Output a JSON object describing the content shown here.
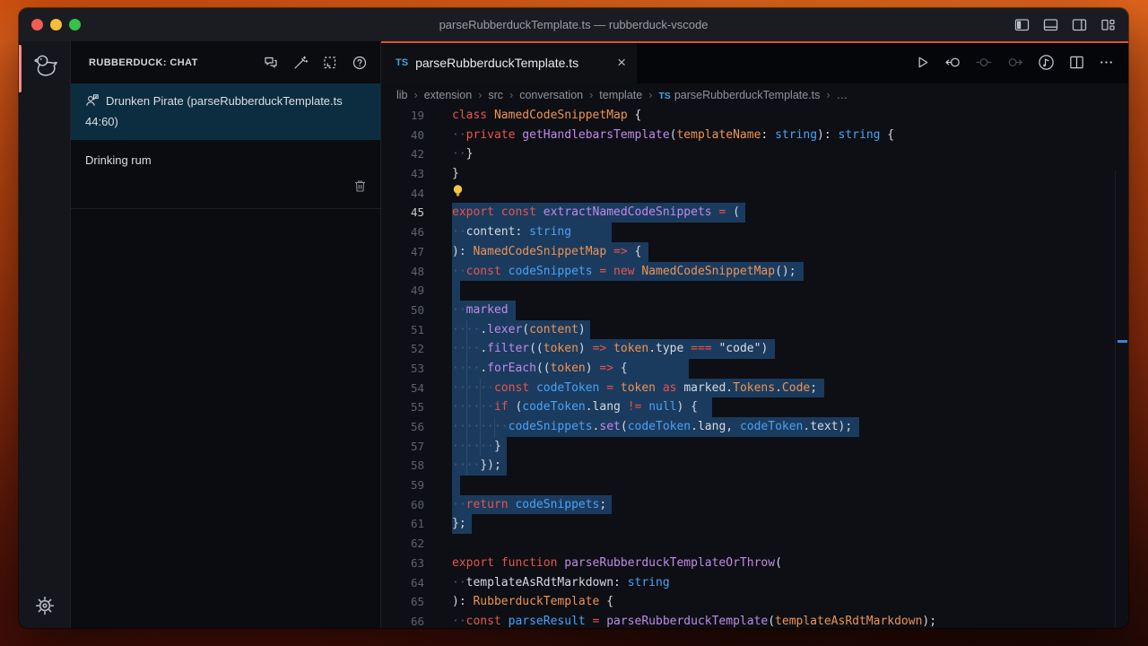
{
  "window": {
    "title": "parseRubberduckTemplate.ts — rubberduck-vscode"
  },
  "sidebar": {
    "header": {
      "title": "RUBBERDUCK: CHAT"
    },
    "items": [
      {
        "title": "Drunken Pirate",
        "subtitle": "(parseRubberduckTemplate.ts 44:60)",
        "selected": true
      },
      {
        "title": "Drinking rum",
        "selected": false
      }
    ]
  },
  "editor": {
    "tab": {
      "badge": "TS",
      "label": "parseRubberduckTemplate.ts",
      "close": "×"
    },
    "breadcrumbs": [
      {
        "label": "lib"
      },
      {
        "label": "extension"
      },
      {
        "label": "src"
      },
      {
        "label": "conversation"
      },
      {
        "label": "template"
      },
      {
        "label": "parseRubberduckTemplate.ts",
        "ts": true
      },
      {
        "label": "…"
      }
    ],
    "code_lines": [
      {
        "num": "19",
        "tokens": [
          [
            "k",
            "class"
          ],
          [
            "d",
            " "
          ],
          [
            "t",
            "NamedCodeSnippetMap"
          ],
          [
            "d",
            " {"
          ]
        ]
      },
      {
        "num": "40",
        "tokens": [
          [
            "w",
            "··"
          ],
          [
            "k",
            "private"
          ],
          [
            "d",
            " "
          ],
          [
            "f",
            "getHandlebarsTemplate"
          ],
          [
            "d",
            "("
          ],
          [
            "t",
            "templateName"
          ],
          [
            "d",
            ": "
          ],
          [
            "v",
            "string"
          ],
          [
            "d",
            "): "
          ],
          [
            "v",
            "string"
          ],
          [
            "d",
            " {"
          ]
        ]
      },
      {
        "num": "42",
        "tokens": [
          [
            "w",
            "··"
          ],
          [
            "d",
            "}"
          ]
        ]
      },
      {
        "num": "43",
        "tokens": [
          [
            "d",
            "}"
          ]
        ]
      },
      {
        "num": "44",
        "bulb": true,
        "tokens": []
      },
      {
        "num": "45",
        "active": true,
        "sel": true,
        "pad": 6,
        "tokens": [
          [
            "k",
            "export"
          ],
          [
            "d",
            " "
          ],
          [
            "k",
            "const"
          ],
          [
            "d",
            " "
          ],
          [
            "f",
            "extractNamedCodeSnippets"
          ],
          [
            "d",
            " "
          ],
          [
            "k",
            "="
          ],
          [
            "d",
            " ("
          ]
        ]
      },
      {
        "num": "46",
        "sel": true,
        "pad": 45,
        "tokens": [
          [
            "w",
            "··"
          ],
          [
            "d",
            "content"
          ],
          [
            "d",
            ": "
          ],
          [
            "v",
            "string"
          ]
        ]
      },
      {
        "num": "47",
        "sel": true,
        "pad": 8,
        "tokens": [
          [
            "d",
            "): "
          ],
          [
            "t",
            "NamedCodeSnippetMap"
          ],
          [
            "d",
            " "
          ],
          [
            "k",
            "=>"
          ],
          [
            "d",
            " {"
          ]
        ]
      },
      {
        "num": "48",
        "sel": true,
        "pad": 8,
        "tokens": [
          [
            "w",
            "··"
          ],
          [
            "k",
            "const"
          ],
          [
            "d",
            " "
          ],
          [
            "v",
            "codeSnippets"
          ],
          [
            "d",
            " "
          ],
          [
            "k",
            "="
          ],
          [
            "d",
            " "
          ],
          [
            "k",
            "new"
          ],
          [
            "d",
            " "
          ],
          [
            "t",
            "NamedCodeSnippetMap"
          ],
          [
            "d",
            "();"
          ]
        ]
      },
      {
        "num": "49",
        "sel": true,
        "pad": 0,
        "tokens": []
      },
      {
        "num": "50",
        "sel": true,
        "pad": 8,
        "tokens": [
          [
            "w",
            "··"
          ],
          [
            "f",
            "marked"
          ]
        ]
      },
      {
        "num": "51",
        "sel": true,
        "pad": 5,
        "guides": [
          2
        ],
        "tokens": [
          [
            "w",
            "····"
          ],
          [
            "d",
            "."
          ],
          [
            "f",
            "lexer"
          ],
          [
            "d",
            "("
          ],
          [
            "t",
            "content"
          ],
          [
            "d",
            ")"
          ]
        ]
      },
      {
        "num": "52",
        "sel": true,
        "pad": 8,
        "guides": [
          2
        ],
        "tokens": [
          [
            "w",
            "····"
          ],
          [
            "d",
            "."
          ],
          [
            "f",
            "filter"
          ],
          [
            "d",
            "(("
          ],
          [
            "t",
            "token"
          ],
          [
            "d",
            ") "
          ],
          [
            "k",
            "=>"
          ],
          [
            "d",
            " "
          ],
          [
            "t",
            "token"
          ],
          [
            "d",
            ".type "
          ],
          [
            "k",
            "==="
          ],
          [
            "d",
            " "
          ],
          [
            "s",
            "\"code\""
          ],
          [
            "d",
            ")"
          ]
        ]
      },
      {
        "num": "53",
        "sel": true,
        "pad": 68,
        "guides": [
          2
        ],
        "tokens": [
          [
            "w",
            "····"
          ],
          [
            "d",
            "."
          ],
          [
            "f",
            "forEach"
          ],
          [
            "d",
            "(("
          ],
          [
            "t",
            "token"
          ],
          [
            "d",
            ") "
          ],
          [
            "k",
            "=>"
          ],
          [
            "d",
            " {"
          ]
        ]
      },
      {
        "num": "54",
        "sel": true,
        "pad": 8,
        "guides": [
          2,
          4
        ],
        "tokens": [
          [
            "w",
            "······"
          ],
          [
            "k",
            "const"
          ],
          [
            "d",
            " "
          ],
          [
            "v",
            "codeToken"
          ],
          [
            "d",
            " "
          ],
          [
            "k",
            "="
          ],
          [
            "d",
            " "
          ],
          [
            "t",
            "token"
          ],
          [
            "d",
            " "
          ],
          [
            "k",
            "as"
          ],
          [
            "d",
            " marked."
          ],
          [
            "t",
            "Tokens"
          ],
          [
            "d",
            "."
          ],
          [
            "t",
            "Code"
          ],
          [
            "d",
            ";"
          ]
        ]
      },
      {
        "num": "55",
        "sel": true,
        "pad": 16,
        "guides": [
          2,
          4
        ],
        "tokens": [
          [
            "w",
            "······"
          ],
          [
            "k",
            "if"
          ],
          [
            "d",
            " ("
          ],
          [
            "v",
            "codeToken"
          ],
          [
            "d",
            ".lang "
          ],
          [
            "k",
            "!="
          ],
          [
            "d",
            " "
          ],
          [
            "v",
            "null"
          ],
          [
            "d",
            ") {"
          ]
        ]
      },
      {
        "num": "56",
        "sel": true,
        "pad": 8,
        "guides": [
          2,
          4,
          6
        ],
        "tokens": [
          [
            "w",
            "········"
          ],
          [
            "v",
            "codeSnippets"
          ],
          [
            "d",
            "."
          ],
          [
            "f",
            "set"
          ],
          [
            "d",
            "("
          ],
          [
            "v",
            "codeToken"
          ],
          [
            "d",
            ".lang, "
          ],
          [
            "v",
            "codeToken"
          ],
          [
            "d",
            ".text);"
          ]
        ]
      },
      {
        "num": "57",
        "sel": true,
        "pad": 6,
        "guides": [
          2,
          4
        ],
        "tokens": [
          [
            "w",
            "······"
          ],
          [
            "d",
            "}"
          ]
        ]
      },
      {
        "num": "58",
        "sel": true,
        "pad": 6,
        "guides": [
          2
        ],
        "tokens": [
          [
            "w",
            "····"
          ],
          [
            "d",
            "});"
          ]
        ]
      },
      {
        "num": "59",
        "sel": true,
        "pad": 0,
        "tokens": []
      },
      {
        "num": "60",
        "sel": true,
        "pad": 6,
        "tokens": [
          [
            "w",
            "··"
          ],
          [
            "k",
            "return"
          ],
          [
            "d",
            " "
          ],
          [
            "v",
            "codeSnippets"
          ],
          [
            "d",
            ";"
          ]
        ]
      },
      {
        "num": "61",
        "sel": true,
        "pad": 6,
        "tokens": [
          [
            "d",
            "};"
          ]
        ]
      },
      {
        "num": "62",
        "tokens": []
      },
      {
        "num": "63",
        "tokens": [
          [
            "k",
            "export"
          ],
          [
            "d",
            " "
          ],
          [
            "k",
            "function"
          ],
          [
            "d",
            " "
          ],
          [
            "f",
            "parseRubberduckTemplateOrThrow"
          ],
          [
            "d",
            "("
          ]
        ]
      },
      {
        "num": "64",
        "tokens": [
          [
            "w",
            "··"
          ],
          [
            "d",
            "templateAsRdtMarkdown"
          ],
          [
            "d",
            ": "
          ],
          [
            "v",
            "string"
          ]
        ]
      },
      {
        "num": "65",
        "tokens": [
          [
            "d",
            "): "
          ],
          [
            "t",
            "RubberduckTemplate"
          ],
          [
            "d",
            " {"
          ]
        ]
      },
      {
        "num": "66",
        "tokens": [
          [
            "w",
            "··"
          ],
          [
            "k",
            "const"
          ],
          [
            "d",
            " "
          ],
          [
            "v",
            "parseResult"
          ],
          [
            "d",
            " "
          ],
          [
            "k",
            "="
          ],
          [
            "d",
            " "
          ],
          [
            "f",
            "parseRubberduckTemplate"
          ],
          [
            "d",
            "("
          ],
          [
            "t",
            "templateAsRdtMarkdown"
          ],
          [
            "d",
            ");"
          ]
        ]
      }
    ]
  },
  "colors": {
    "accent_top_line": "#e0503b",
    "selection": "#1b3b5e",
    "sidebar_selected_item": "#0c2d3f",
    "activity_indicator": "#f08d8a",
    "keyword": "#e8544a",
    "function": "#c18ae8",
    "type": "#ef9352",
    "variable": "#4aa2f5",
    "ts_badge": "#4aa0dd"
  }
}
